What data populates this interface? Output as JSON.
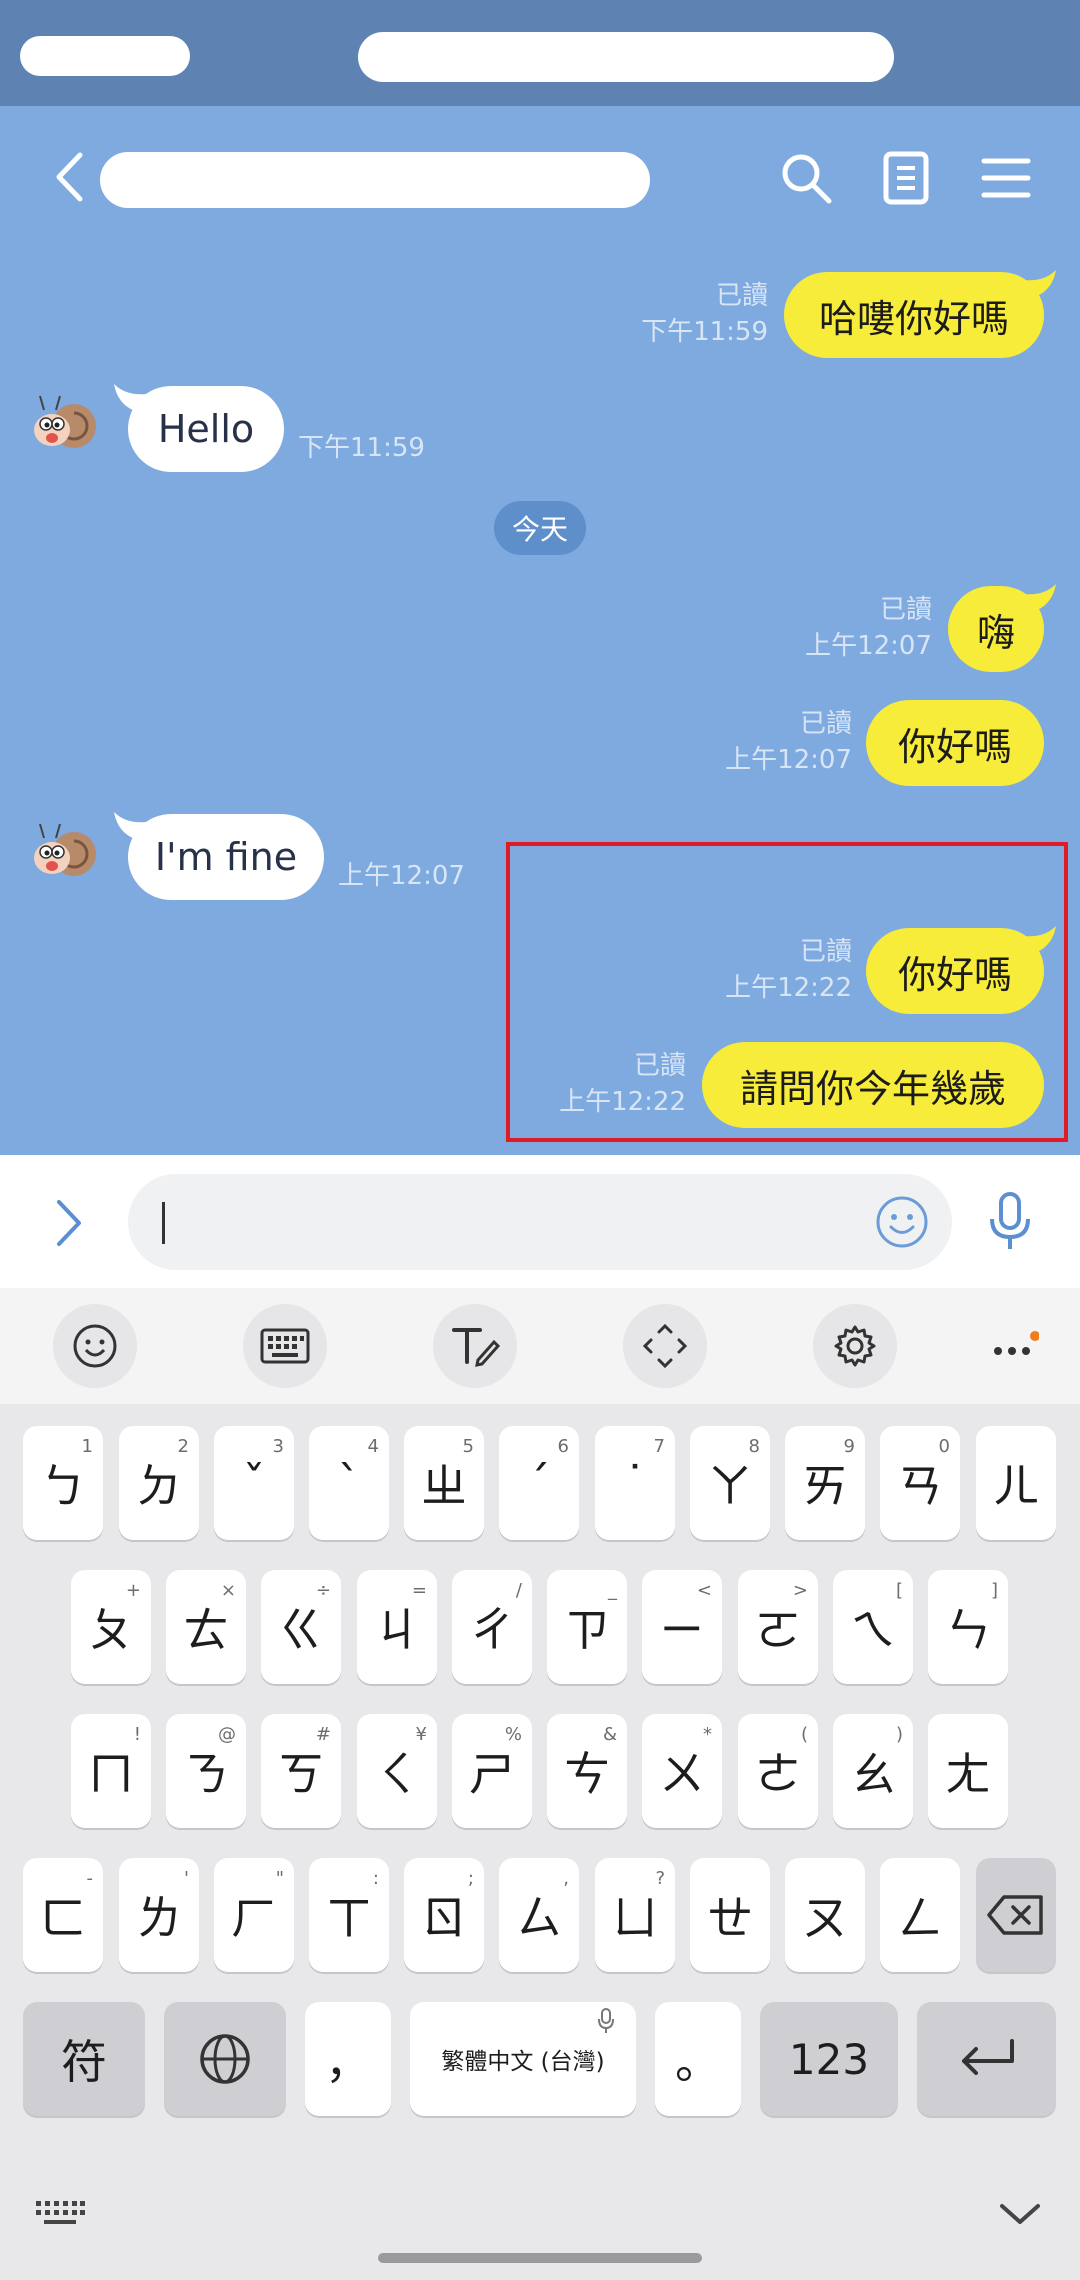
{
  "chat": {
    "messages_mine": [
      {
        "text": "哈嘍你好嗎",
        "read": "已讀",
        "time": "下午11:59"
      },
      {
        "text": "嗨",
        "read": "已讀",
        "time": "上午12:07"
      },
      {
        "text": "你好嗎",
        "read": "已讀",
        "time": "上午12:07"
      },
      {
        "text": "你好嗎",
        "read": "已讀",
        "time": "上午12:22"
      },
      {
        "text": "請問你今年幾歲",
        "read": "已讀",
        "time": "上午12:22"
      }
    ],
    "messages_theirs": [
      {
        "text": "Hello",
        "time": "下午11:59"
      },
      {
        "text": "I'm fine",
        "time": "上午12:07"
      }
    ],
    "date_divider": "今天"
  },
  "keyboard": {
    "row1": [
      {
        "label": "ㄅ",
        "sub": "1"
      },
      {
        "label": "ㄉ",
        "sub": "2"
      },
      {
        "label": "ˇ",
        "sub": "3"
      },
      {
        "label": "ˋ",
        "sub": "4"
      },
      {
        "label": "ㄓ",
        "sub": "5"
      },
      {
        "label": "ˊ",
        "sub": "6"
      },
      {
        "label": "˙",
        "sub": "7"
      },
      {
        "label": "ㄚ",
        "sub": "8"
      },
      {
        "label": "ㄞ",
        "sub": "9"
      },
      {
        "label": "ㄢ",
        "sub": "0"
      },
      {
        "label": "ㄦ",
        "sub": ""
      }
    ],
    "row2": [
      {
        "label": "ㄆ",
        "sub": "+"
      },
      {
        "label": "ㄊ",
        "sub": "×"
      },
      {
        "label": "ㄍ",
        "sub": "÷"
      },
      {
        "label": "ㄐ",
        "sub": "="
      },
      {
        "label": "ㄔ",
        "sub": "/"
      },
      {
        "label": "ㄗ",
        "sub": "_"
      },
      {
        "label": "ㄧ",
        "sub": "<"
      },
      {
        "label": "ㄛ",
        "sub": ">"
      },
      {
        "label": "ㄟ",
        "sub": "["
      },
      {
        "label": "ㄣ",
        "sub": "]"
      }
    ],
    "row3": [
      {
        "label": "ㄇ",
        "sub": "!"
      },
      {
        "label": "ㄋ",
        "sub": "@"
      },
      {
        "label": "ㄎ",
        "sub": "#"
      },
      {
        "label": "ㄑ",
        "sub": "¥"
      },
      {
        "label": "ㄕ",
        "sub": "%"
      },
      {
        "label": "ㄘ",
        "sub": "&"
      },
      {
        "label": "ㄨ",
        "sub": "*"
      },
      {
        "label": "ㄜ",
        "sub": "("
      },
      {
        "label": "ㄠ",
        "sub": ")"
      },
      {
        "label": "ㄤ",
        "sub": ""
      }
    ],
    "row4": [
      {
        "label": "ㄈ",
        "sub": "-"
      },
      {
        "label": "ㄌ",
        "sub": "'"
      },
      {
        "label": "ㄏ",
        "sub": "\""
      },
      {
        "label": "ㄒ",
        "sub": ":"
      },
      {
        "label": "ㄖ",
        "sub": ";"
      },
      {
        "label": "ㄙ",
        "sub": ","
      },
      {
        "label": "ㄩ",
        "sub": "?"
      },
      {
        "label": "ㄝ",
        "sub": ""
      },
      {
        "label": "ㄡ",
        "sub": ""
      },
      {
        "label": "ㄥ",
        "sub": ""
      }
    ],
    "symbols_key": "符",
    "comma_key": "，",
    "space_key": "繁體中文 (台灣)",
    "period_key": "。",
    "numbers_key": "123"
  },
  "colors": {
    "chat_bg": "#7eaae0",
    "my_bubble": "#f7ec3a",
    "highlight": "#e01b24",
    "status_bar": "#5e83b2"
  }
}
